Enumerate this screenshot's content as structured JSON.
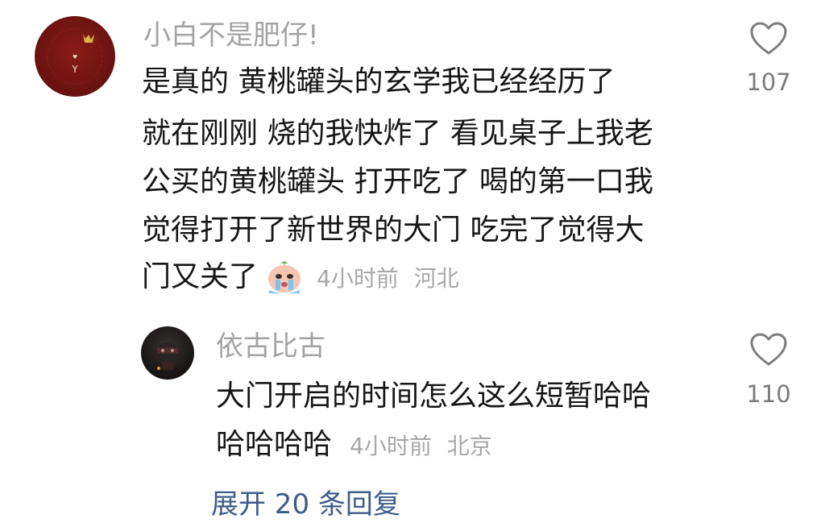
{
  "comment": {
    "username": "小白不是肥仔!",
    "lines": [
      "是真的  黄桃罐头的玄学我已经经历了",
      "就在刚刚 烧的我快炸了  看见桌子上我老",
      "公买的黄桃罐头 打开吃了  喝的第一口我",
      "觉得打开了新世界的大门  吃完了觉得大",
      "门又关了"
    ],
    "emoji": "crying-face-emoji",
    "time": "4小时前",
    "location": "河北",
    "like_count": "107"
  },
  "reply": {
    "username": "依古比古",
    "lines": [
      "大门开启的时间怎么这么短暂哈哈",
      "哈哈哈哈"
    ],
    "time": "4小时前",
    "location": "北京",
    "like_count": "110"
  },
  "expand_replies": "展开 20 条回复",
  "colors": {
    "username": "#a3a3a3",
    "text": "#161616",
    "meta": "#a8a8a8",
    "link": "#3d5c8a",
    "avatar_main": "#6d1311"
  },
  "icons": [
    "heart-outline-icon",
    "crown-icon",
    "crying-face-emoji"
  ]
}
